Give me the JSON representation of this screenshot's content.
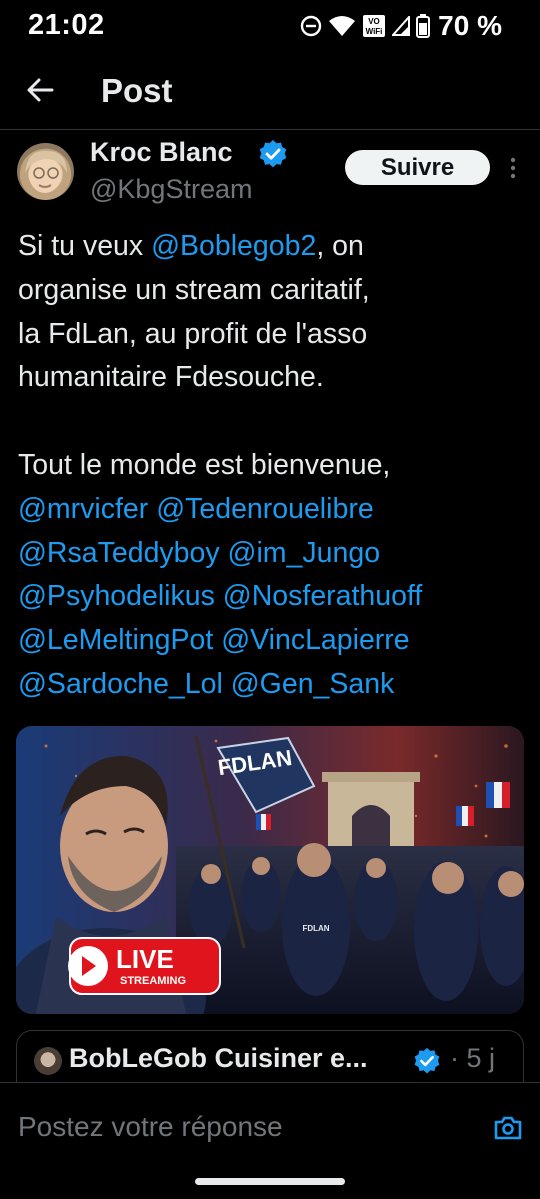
{
  "status_bar": {
    "time": "21:02",
    "volte_top": "VO",
    "volte_bottom": "WiFi",
    "battery": "70 %",
    "icons": [
      "dnd-icon",
      "wifi-icon",
      "vowifi-icon",
      "signal-icon",
      "battery-icon"
    ]
  },
  "header": {
    "title": "Post",
    "back_icon": "arrow-left-icon"
  },
  "post": {
    "author_name": "Kroc Blanc",
    "author_handle": "@KbgStream",
    "follow_label": "Suivre",
    "text_lines": [
      [
        {
          "t": "Si tu veux "
        },
        {
          "t": "@Boblegob2",
          "m": true
        },
        {
          "t": ", on"
        }
      ],
      [
        {
          "t": "organise un stream caritatif,"
        }
      ],
      [
        {
          "t": "la FdLan, au profit de l'asso"
        }
      ],
      [
        {
          "t": "humanitaire Fdesouche."
        }
      ],
      [],
      [
        {
          "t": "Tout le monde est bienvenue,"
        }
      ],
      [
        {
          "t": "@mrvicfer",
          "m": true
        },
        {
          "t": " "
        },
        {
          "t": "@Tedenrouelibre",
          "m": true
        }
      ],
      [
        {
          "t": "@RsaTeddyboy",
          "m": true
        },
        {
          "t": " "
        },
        {
          "t": "@im_Jungo",
          "m": true
        }
      ],
      [
        {
          "t": "@Psyhodelikus",
          "m": true
        },
        {
          "t": " "
        },
        {
          "t": "@Nosferathuoff",
          "m": true
        }
      ],
      [
        {
          "t": "@LeMeltingPot",
          "m": true
        },
        {
          "t": " "
        },
        {
          "t": "@VincLapierre",
          "m": true
        }
      ],
      [
        {
          "t": "@Sardoche_Lol",
          "m": true
        },
        {
          "t": " "
        },
        {
          "t": "@Gen_Sank",
          "m": true
        }
      ]
    ],
    "media": {
      "logo_text": "FDLAN",
      "live_label": "LIVE",
      "live_sub": "STREAMING",
      "jacket_text": "FDLAN"
    }
  },
  "quote": {
    "name": "BobLeGob Cuisiner e...",
    "time": "· 5 j"
  },
  "reply": {
    "placeholder": "Postez votre réponse"
  },
  "colors": {
    "accent": "#1d9bf0",
    "text": "#e7e9ea",
    "muted": "#71767b",
    "bg": "#000000",
    "live_red": "#e0141c"
  }
}
